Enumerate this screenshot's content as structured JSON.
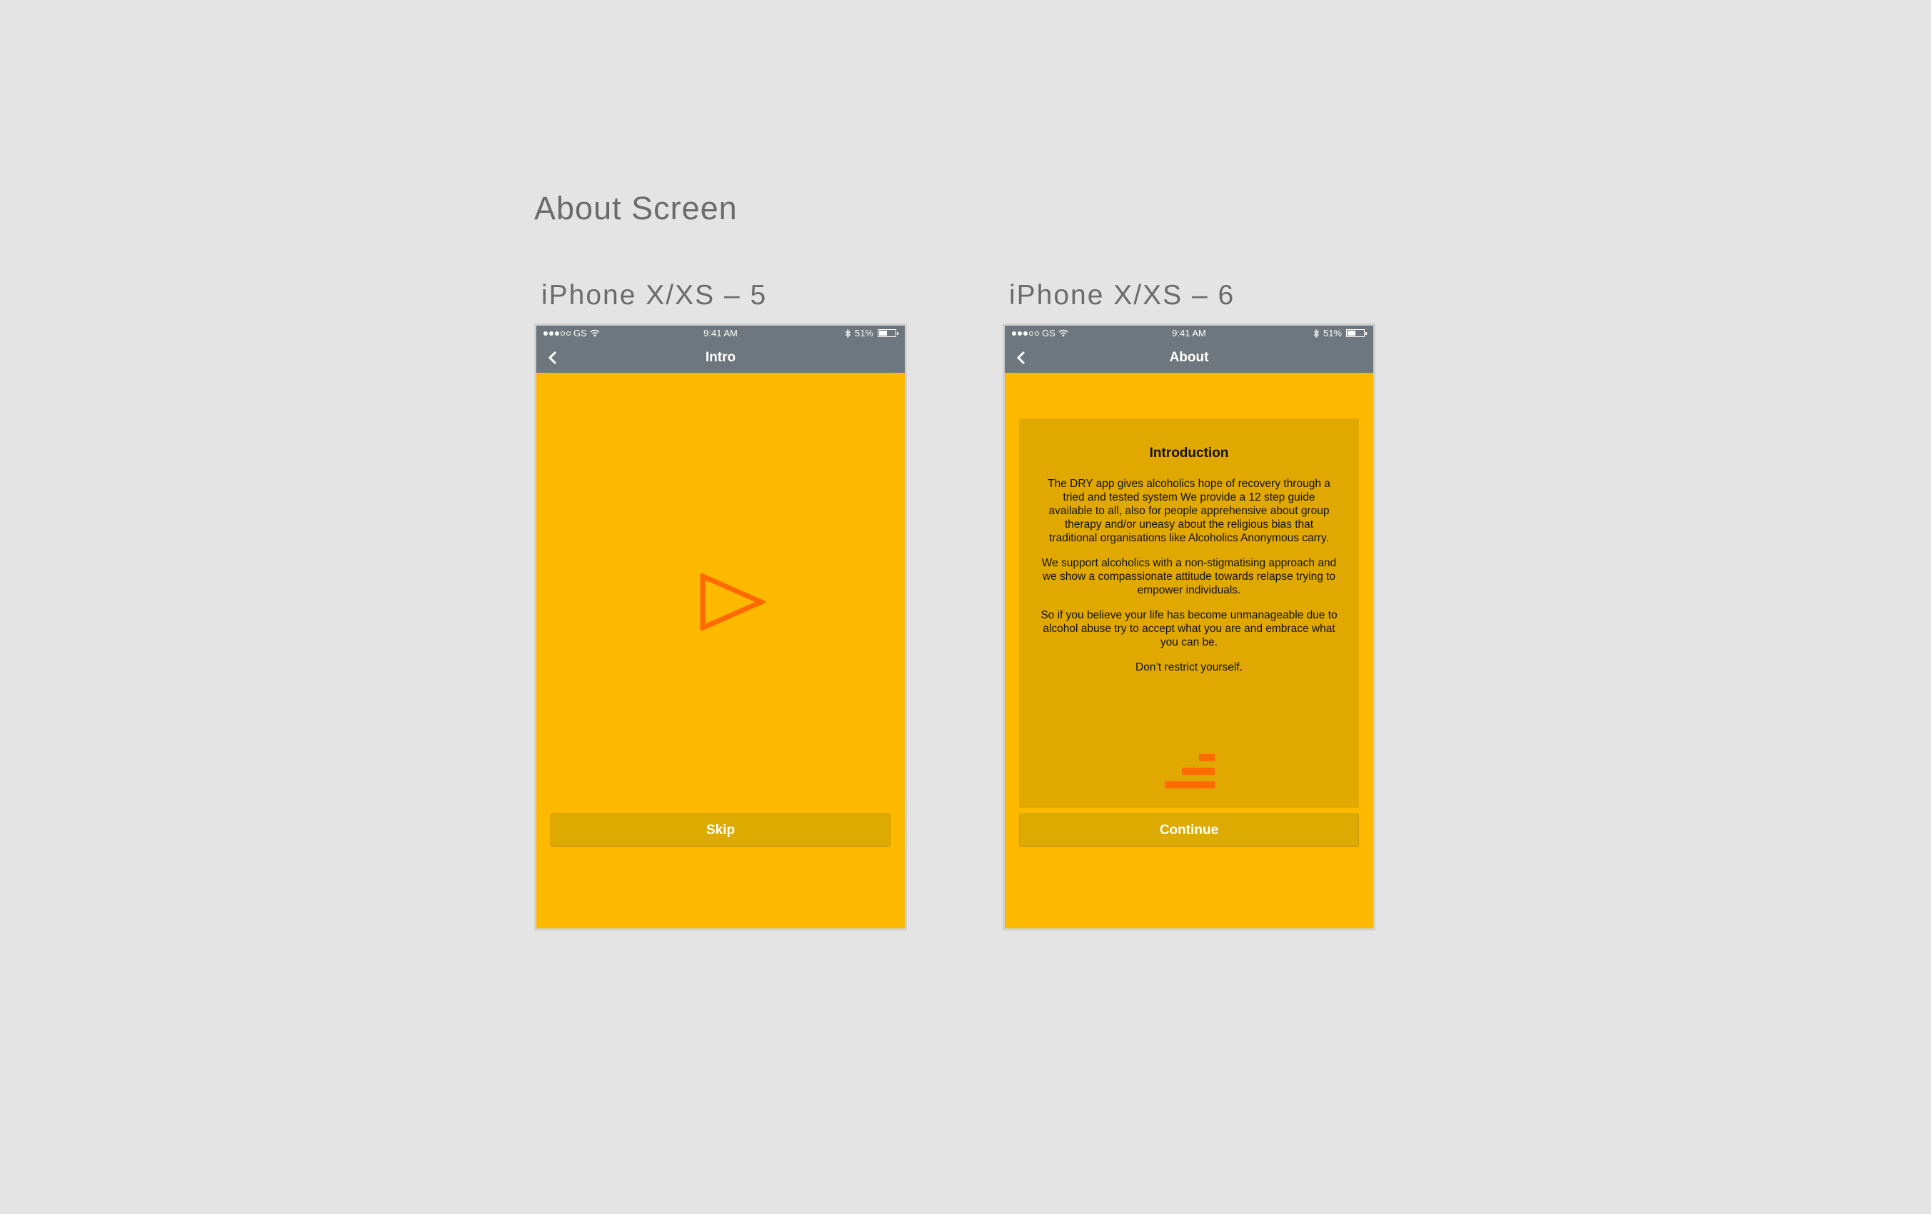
{
  "page": {
    "title": "About Screen"
  },
  "screens": [
    {
      "frame_label": "iPhone X/XS – 5",
      "status": {
        "carrier": "GS",
        "time": "9:41 AM",
        "battery": "51%"
      },
      "nav": {
        "title": "Intro"
      },
      "button": {
        "label": "Skip"
      }
    },
    {
      "frame_label": "iPhone X/XS – 6",
      "status": {
        "carrier": "GS",
        "time": "9:41 AM",
        "battery": "51%"
      },
      "nav": {
        "title": "About"
      },
      "card": {
        "heading": "Introduction",
        "paragraphs": [
          "The DRY app gives alcoholics hope of recovery through a tried and tested system We provide a 12 step guide available to all, also for people apprehensive about group therapy and/or uneasy about the religious bias that traditional organisations like Alcoholics Anonymous carry.",
          "We support alcoholics with a non-stigmatising approach and we show a compassionate attitude towards relapse trying to empower individuals.",
          "So if you believe your life has become unmanageable due to alcohol abuse try to accept what you are and embrace what you can be.",
          "Don’t restrict yourself."
        ]
      },
      "button": {
        "label": "Continue"
      }
    }
  ],
  "colors": {
    "background": "#e4e4e4",
    "screen": "#fdb800",
    "bar": "#6e777e",
    "card": "#e0a800",
    "button": "#dcaa00",
    "accent": "#ff6a00"
  },
  "icons": [
    "back-chevron-icon",
    "play-icon",
    "wifi-icon",
    "bluetooth-icon",
    "battery-icon",
    "dry-logo-icon"
  ]
}
